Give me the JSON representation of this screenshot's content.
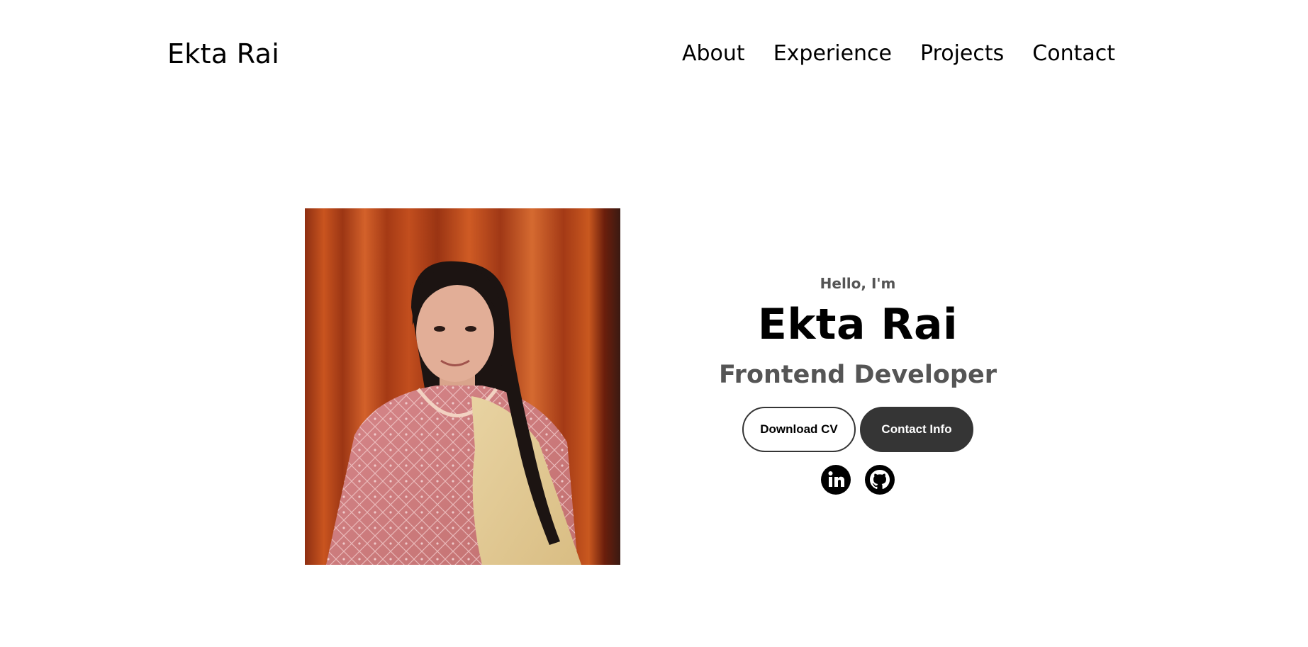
{
  "header": {
    "logo": "Ekta Rai",
    "nav": [
      {
        "label": "About"
      },
      {
        "label": "Experience"
      },
      {
        "label": "Projects"
      },
      {
        "label": "Contact"
      }
    ]
  },
  "hero": {
    "greeting": "Hello, I'm",
    "name": "Ekta Rai",
    "role": "Frontend Developer",
    "download_cv_label": "Download CV",
    "contact_info_label": "Contact Info",
    "photo_alt": "Profile picture",
    "social_icons": [
      "linkedin-icon",
      "github-icon"
    ]
  },
  "colors": {
    "button_dark": "#353535",
    "muted_text": "#555555",
    "curtain": "#b8461c"
  }
}
